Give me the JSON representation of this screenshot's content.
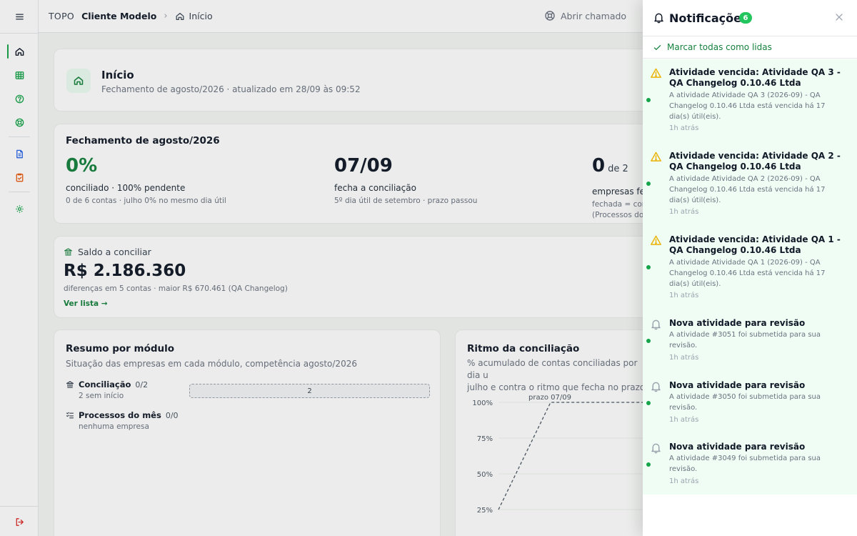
{
  "topbar": {
    "org": "TOPO",
    "client": "Cliente Modelo",
    "page": "Início",
    "open_ticket": "Abrir chamado"
  },
  "hero": {
    "title": "Início",
    "subtitle": "Fechamento de agosto/2026 · atualizado em 28/09 às 09:52"
  },
  "closing": {
    "title": "Fechamento de agosto/2026",
    "reconciled": {
      "value": "0%",
      "label": "conciliado · 100% pendente",
      "note": "0 de 6 contas · julho 0% no mesmo dia útil"
    },
    "deadline": {
      "value": "07/09",
      "label": "fecha a conciliação",
      "note": "5º dia útil de setembro · prazo passou"
    },
    "companies": {
      "value": "0",
      "of": "de 2",
      "label": "empresas fec",
      "note_1": "fechada = conc",
      "note_2": "(Processos do"
    }
  },
  "balance": {
    "title": "Saldo a conciliar",
    "value": "R$ 2.186.360",
    "note": "diferenças em 5 contas · maior R$ 670.461 (QA Changelog)",
    "link": "Ver lista →"
  },
  "modules": {
    "title": "Resumo por módulo",
    "subtitle": "Situação das empresas em cada módulo, competência agosto/2026",
    "rows": [
      {
        "name": "Conciliação",
        "count": "0/2",
        "note": "2 sem início",
        "bar_label": "2"
      },
      {
        "name": "Processos do mês",
        "count": "0/0",
        "note": "nenhuma empresa"
      }
    ]
  },
  "rhythm": {
    "title": "Ritmo da conciliação",
    "subtitle_1": "% acumulado de contas conciliadas por dia u",
    "subtitle_2": "julho e contra o ritmo que fecha no prazo",
    "chart_data": {
      "type": "line",
      "title": "Ritmo da conciliação",
      "yticks": [
        "100%",
        "75%",
        "50%",
        "25%"
      ],
      "ylim": [
        25,
        100
      ],
      "annotation": "prazo 07/09",
      "series": [
        {
          "name": "",
          "style": "dashed",
          "points": [
            {
              "x": 0,
              "y": 25
            },
            {
              "x": 1,
              "y": 100
            },
            {
              "x": 2,
              "y": 100
            }
          ]
        }
      ]
    }
  },
  "notifications": {
    "title": "Notificações",
    "count": "6",
    "mark_all": "Marcar todas como lidas",
    "items": [
      {
        "kind": "warning",
        "title": "Atividade vencida: Atividade QA 3 - QA Changelog 0.10.46 Ltda",
        "body": "A atividade Atividade QA 3 (2026-09) - QA Changelog 0.10.46 Ltda está vencida há 17 dia(s) útil(eis).",
        "time": "1h atrás"
      },
      {
        "kind": "warning",
        "title": "Atividade vencida: Atividade QA 2 - QA Changelog 0.10.46 Ltda",
        "body": "A atividade Atividade QA 2 (2026-09) - QA Changelog 0.10.46 Ltda está vencida há 17 dia(s) útil(eis).",
        "time": "1h atrás"
      },
      {
        "kind": "warning",
        "title": "Atividade vencida: Atividade QA 1 - QA Changelog 0.10.46 Ltda",
        "body": "A atividade Atividade QA 1 (2026-09) - QA Changelog 0.10.46 Ltda está vencida há 17 dia(s) útil(eis).",
        "time": "1h atrás"
      },
      {
        "kind": "bell",
        "title": "Nova atividade para revisão",
        "body": "A atividade #3051 foi submetida para sua revisão.",
        "time": "1h atrás"
      },
      {
        "kind": "bell",
        "title": "Nova atividade para revisão",
        "body": "A atividade #3050 foi submetida para sua revisão.",
        "time": "1h atrás"
      },
      {
        "kind": "bell",
        "title": "Nova atividade para revisão",
        "body": "A atividade #3049 foi submetida para sua revisão.",
        "time": "1h atrás"
      }
    ]
  },
  "colors": {
    "accent": "#16a34a",
    "warning": "#eab308",
    "unread_bg": "#f0fdf4"
  }
}
